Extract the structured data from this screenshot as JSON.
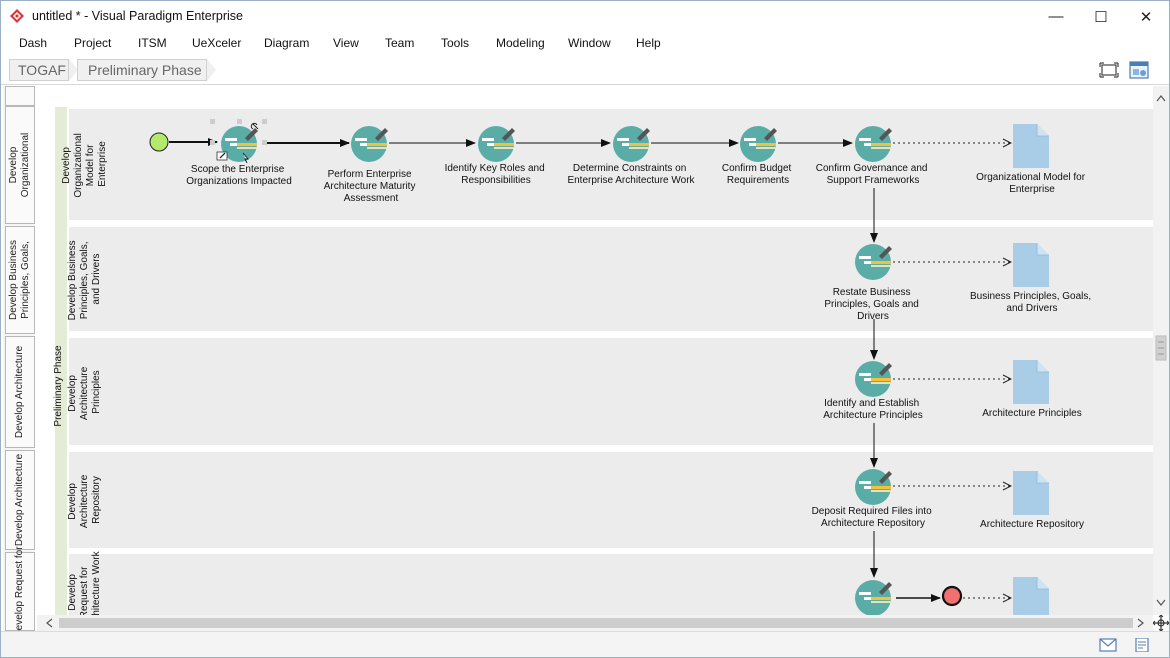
{
  "window": {
    "title": "untitled * - Visual Paradigm Enterprise",
    "controls": {
      "minimize": "—",
      "maximize": "☐",
      "close": "✕"
    }
  },
  "menu": [
    "Dash",
    "Project",
    "ITSM",
    "UeXceler",
    "Diagram",
    "View",
    "Team",
    "Tools",
    "Modeling",
    "Window",
    "Help"
  ],
  "breadcrumb": [
    "TOGAF",
    "Preliminary Phase"
  ],
  "left_tabs": [
    "Develop Organizational",
    "Develop Business Principles, Goals,",
    "Develop Architecture",
    "Develop Architecture",
    "Develop Request for"
  ],
  "pool": {
    "label": "Preliminary Phase"
  },
  "lanes": [
    "Develop Organizational Model for Enterprise",
    "Develop Business Principles, Goals, and Drivers",
    "Develop Architecture Principles",
    "Develop Architecture Repository",
    "Develop Request for Architecture Work"
  ],
  "tasks": [
    "Scope the Enterprise Organizations Impacted",
    "Perform Enterprise Architecture Maturity Assessment",
    "Identify Key Roles and Responsibilities",
    "Determine Constraints on Enterprise Architecture Work",
    "Confirm Budget Requirements",
    "Confirm Governance and Support Frameworks",
    "Restate Business Principles, Goals and Drivers",
    "Identify and Establish Architecture Principles",
    "Deposit Required Files into Architecture Repository",
    ""
  ],
  "artifacts": [
    "Organizational Model for Enterprise",
    "Business Principles, Goals, and Drivers",
    "Architecture Principles",
    "Architecture Repository",
    ""
  ],
  "colors": {
    "task_fill": "#5aada6",
    "artifact_fill": "#a9cde6",
    "start_fill": "#b4ea6c",
    "end_fill": "#f07070",
    "lane_fill": "#ececec",
    "pool_stripe": "#e4ecd6"
  },
  "icons": {
    "app": "visual-paradigm-logo-icon",
    "fit": "fit-diagram-icon",
    "panel": "diagram-panel-icon",
    "mail": "mail-icon",
    "note": "note-icon",
    "navigator": "pan-navigator-icon"
  }
}
